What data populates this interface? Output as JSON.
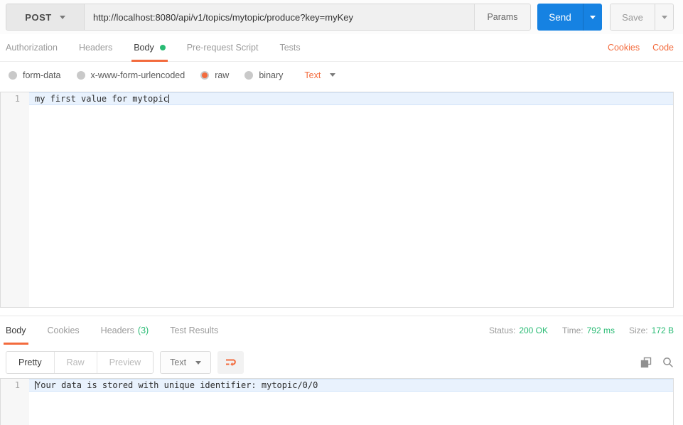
{
  "request_bar": {
    "method": "POST",
    "url": "http://localhost:8080/api/v1/topics/mytopic/produce?key=myKey",
    "params_label": "Params",
    "send_label": "Send",
    "save_label": "Save"
  },
  "request_tabs": {
    "items": [
      {
        "label": "Authorization",
        "active": false
      },
      {
        "label": "Headers",
        "active": false
      },
      {
        "label": "Body",
        "active": true,
        "unsaved_dot": true
      },
      {
        "label": "Pre-request Script",
        "active": false
      },
      {
        "label": "Tests",
        "active": false
      }
    ],
    "cookies_label": "Cookies",
    "code_label": "Code"
  },
  "body_type": {
    "options": [
      {
        "label": "form-data",
        "selected": false
      },
      {
        "label": "x-www-form-urlencoded",
        "selected": false
      },
      {
        "label": "raw",
        "selected": true
      },
      {
        "label": "binary",
        "selected": false
      }
    ],
    "format_label": "Text"
  },
  "request_editor": {
    "line_number": "1",
    "content": "my first value for mytopic"
  },
  "response": {
    "tabs": [
      {
        "label": "Body",
        "active": true
      },
      {
        "label": "Cookies",
        "active": false
      },
      {
        "label": "Headers",
        "count": "(3)",
        "active": false
      },
      {
        "label": "Test Results",
        "active": false
      }
    ],
    "status_label": "Status:",
    "status_value": "200 OK",
    "time_label": "Time:",
    "time_value": "792 ms",
    "size_label": "Size:",
    "size_value": "172 B",
    "view_modes": [
      {
        "label": "Pretty",
        "active": true
      },
      {
        "label": "Raw",
        "active": false
      },
      {
        "label": "Preview",
        "active": false
      }
    ],
    "format_label": "Text",
    "editor": {
      "line_number": "1",
      "content": "Your data is stored with unique identifier: mytopic/0/0"
    }
  },
  "icons": {
    "method_caret": "chevron-down-icon",
    "wrap": "wrap-text-icon",
    "copy": "copy-icon",
    "search": "search-icon"
  },
  "colors": {
    "accent_orange": "#f36b3d",
    "success_green": "#29bb74",
    "send_blue": "#1682e2"
  }
}
